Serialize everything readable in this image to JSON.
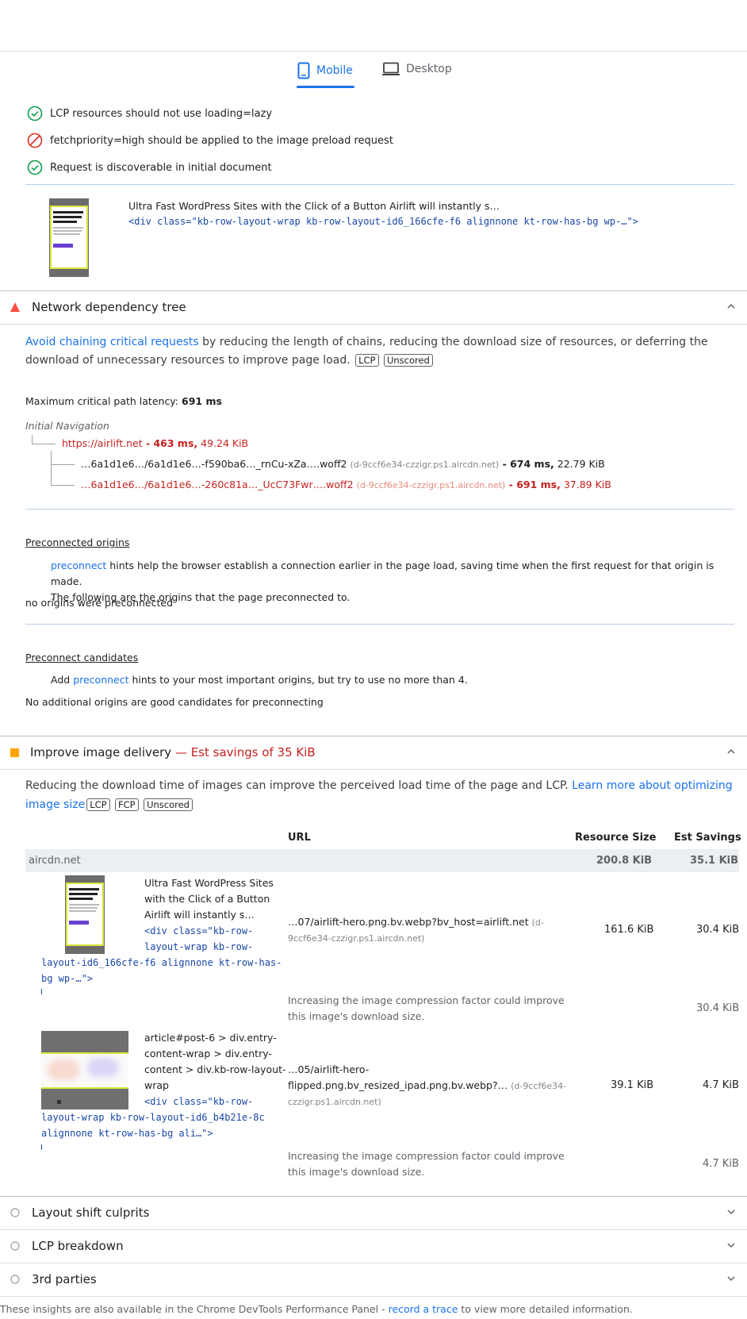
{
  "tabs": {
    "mobile": "Mobile",
    "desktop": "Desktop"
  },
  "lcp_checks": [
    {
      "status": "pass",
      "label": "LCP resources should not use loading=lazy"
    },
    {
      "status": "fail",
      "label": "fetchpriority=high should be applied to the image preload request"
    },
    {
      "status": "pass",
      "label": "Request is discoverable in initial document"
    }
  ],
  "lcp_element": {
    "text": "Ultra Fast WordPress Sites with the Click of a Button Airlift will instantly s…",
    "snippet": "<div class=\"kb-row-layout-wrap kb-row-layout-id6_166cfe-f6 alignnone kt-row-has-bg wp-…\">"
  },
  "network_tree": {
    "title": "Network dependency tree",
    "desc_link": "Avoid chaining critical requests",
    "desc_rest_1": " by reducing the length of chains, reducing the download size of resources, or deferring the",
    "desc_rest_2": "download of unnecessary resources to improve page load.",
    "badges": [
      "LCP",
      "Unscored"
    ],
    "max_latency_label": "Maximum critical path latency: ",
    "max_latency_value": "691 ms",
    "initial_nav": "Initial Navigation",
    "root": {
      "url": "https://airlift.net",
      "time": " - 463 ms,",
      "size": " 49.24 KiB"
    },
    "children": [
      {
        "url": "…6a1d1e6…/6a1d1e6…-f590ba6…_rnCu-xZa….woff2",
        "host": "(d-9ccf6e34-czzigr.ps1.aircdn.net)",
        "time": " - 674 ms,",
        "size": " 22.79 KiB",
        "critical": false
      },
      {
        "url": "…6a1d1e6…/6a1d1e6…-260c81a…_UcC73Fwr….woff2",
        "host": "(d-9ccf6e34-czzigr.ps1.aircdn.net)",
        "time": " - 691 ms,",
        "size": " 37.89 KiB",
        "critical": true
      }
    ],
    "preconnected": {
      "title": "Preconnected origins",
      "link": "preconnect",
      "text_1": " hints help the browser establish a connection earlier in the page load, saving time when the first request for that origin is made.",
      "text_2": "The following are the origins that the page preconnected to.",
      "empty": "no origins were preconnected"
    },
    "candidates": {
      "title": "Preconnect candidates",
      "prefix": "Add ",
      "link": "preconnect",
      "suffix": " hints to your most important origins, but try to use no more than 4.",
      "empty": "No additional origins are good candidates for preconnecting"
    }
  },
  "image_delivery": {
    "title": "Improve image delivery",
    "savings": " — Est savings of 35 KiB",
    "desc": "Reducing the download time of images can improve the perceived load time of the page and LCP. ",
    "desc_link_1": "Learn more about optimizing",
    "desc_link_2": "image size",
    "badges": [
      "LCP",
      "FCP",
      "Unscored"
    ],
    "columns": {
      "url": "URL",
      "size": "Resource Size",
      "savings": "Est Savings"
    },
    "group": {
      "name": "aircdn.net",
      "size": "200.8 KiB",
      "savings": "35.1 KiB"
    },
    "rows": [
      {
        "text_lines": [
          "Ultra Fast WordPress Sites",
          "with the Click of a Button",
          "Airlift will instantly s…"
        ],
        "snippet_lines": [
          "<div class=\"kb-row-",
          "layout-wrap kb-row-",
          "layout-id6_166cfe-f6 alignnone kt-row-has-",
          "bg wp-…\">"
        ],
        "url": "…07/airlift-hero.png.bv.webp?bv_host=airlift.net",
        "host_1": "(d-",
        "host_2": "9ccf6e34-czzigr.ps1.aircdn.net)",
        "size": "161.6 KiB",
        "savings": "30.4 KiB",
        "sub_text_1": "Increasing the image compression factor could improve",
        "sub_text_2": "this image's download size.",
        "sub_savings": "30.4 KiB"
      },
      {
        "text_lines": [
          "article#post-6 > div.entry-",
          "content-wrap > div.entry-",
          "content > div.kb-row-layout-",
          "wrap"
        ],
        "snippet_lines": [
          "<div class=\"kb-row-",
          "layout-wrap kb-row-layout-id6_b4b21e-8c",
          "alignnone kt-row-has-bg ali…\">"
        ],
        "url_1": "…05/airlift-hero-",
        "url_2": "flipped.png.bv_resized_ipad.png.bv.webp?…",
        "host_1": "(d-9ccf6e34-",
        "host_2": "czzigr.ps1.aircdn.net)",
        "size": "39.1 KiB",
        "savings": "4.7 KiB",
        "sub_text_1": "Increasing the image compression factor could improve",
        "sub_text_2": "this image's download size.",
        "sub_savings": "4.7 KiB"
      }
    ]
  },
  "collapsed_audits": [
    "Layout shift culprits",
    "LCP breakdown",
    "3rd parties"
  ],
  "footer": {
    "text_1": "These insights are also available in the Chrome DevTools Performance Panel - ",
    "link": "record a trace",
    "text_2": " to view more detailed information."
  }
}
